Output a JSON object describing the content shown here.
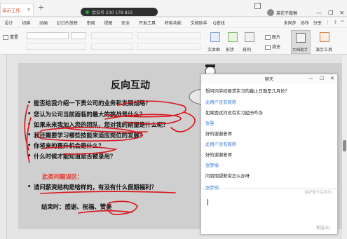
{
  "app": {
    "doc_tab": "演示工作",
    "tab_close": "✕",
    "tab_add": "+",
    "recording": "会议号 230 178 823",
    "user_name": "莱花不做懒",
    "window_controls": [
      "—",
      "❐",
      "✕"
    ]
  },
  "menu": {
    "items": [
      "设计",
      "切换",
      "动画",
      "幻灯片放映",
      "审阅",
      "视图",
      "安全",
      "开发工具",
      "特色功能",
      "文档助手"
    ],
    "search": "Q查找",
    "right": [
      "未同步",
      "协作",
      "分享",
      "⋮",
      "?",
      "^"
    ]
  },
  "ribbon": {
    "reset": "重置",
    "textbox": "文本框",
    "shape": "形状",
    "arrange": "排列",
    "picture": "图片",
    "fill": "填充",
    "doc_helper": "文档助手",
    "presenter": "演示工具"
  },
  "slide": {
    "title": "反向互动",
    "bullets": [
      "能否给我介绍一下贵公司的业务和发展战略？",
      "您认为公司当前面临的最大的挑战是什么？",
      "如果未来我加入您的团队，您对我的期望是什么呢？",
      "我还需要学习哪些技能来适应岗位的发展？",
      "你将来的晋升机会是什么？",
      "什么时候才能知道是否被录用？"
    ],
    "section_title": "此类问题误区：",
    "section_bullet": "请问薪资结构是啥样的，有没有什么假期福利？",
    "closing": "结束时：感谢、祝福、赞美"
  },
  "chat": {
    "title": "聊天",
    "controls": [
      "—",
      "☐",
      "✕"
    ],
    "messages": [
      {
        "kind": "text",
        "text": "想问问学校要求实习的截止日期是几月份？"
      },
      {
        "kind": "name",
        "text": "此用户没有昵称"
      },
      {
        "kind": "text",
        "text": "如果面试问没有实习经历咋办"
      },
      {
        "kind": "name",
        "text": "张慧"
      },
      {
        "kind": "text",
        "text": "好的谢谢老师"
      },
      {
        "kind": "name",
        "text": "此用户没有昵称"
      },
      {
        "kind": "text",
        "text": "好的谢谢老师"
      },
      {
        "kind": "name",
        "text": "张梦楠"
      },
      {
        "kind": "text",
        "text": "问到期望薪资怎么办呀"
      },
      {
        "kind": "name",
        "text": "张梦楠"
      }
    ],
    "placeholder": "最好聊天后提问",
    "send": "发送(S)"
  },
  "colors": {
    "accent_red": "#e4342a",
    "link_blue": "#3b7bd9",
    "ink_red": "#d9141b"
  }
}
